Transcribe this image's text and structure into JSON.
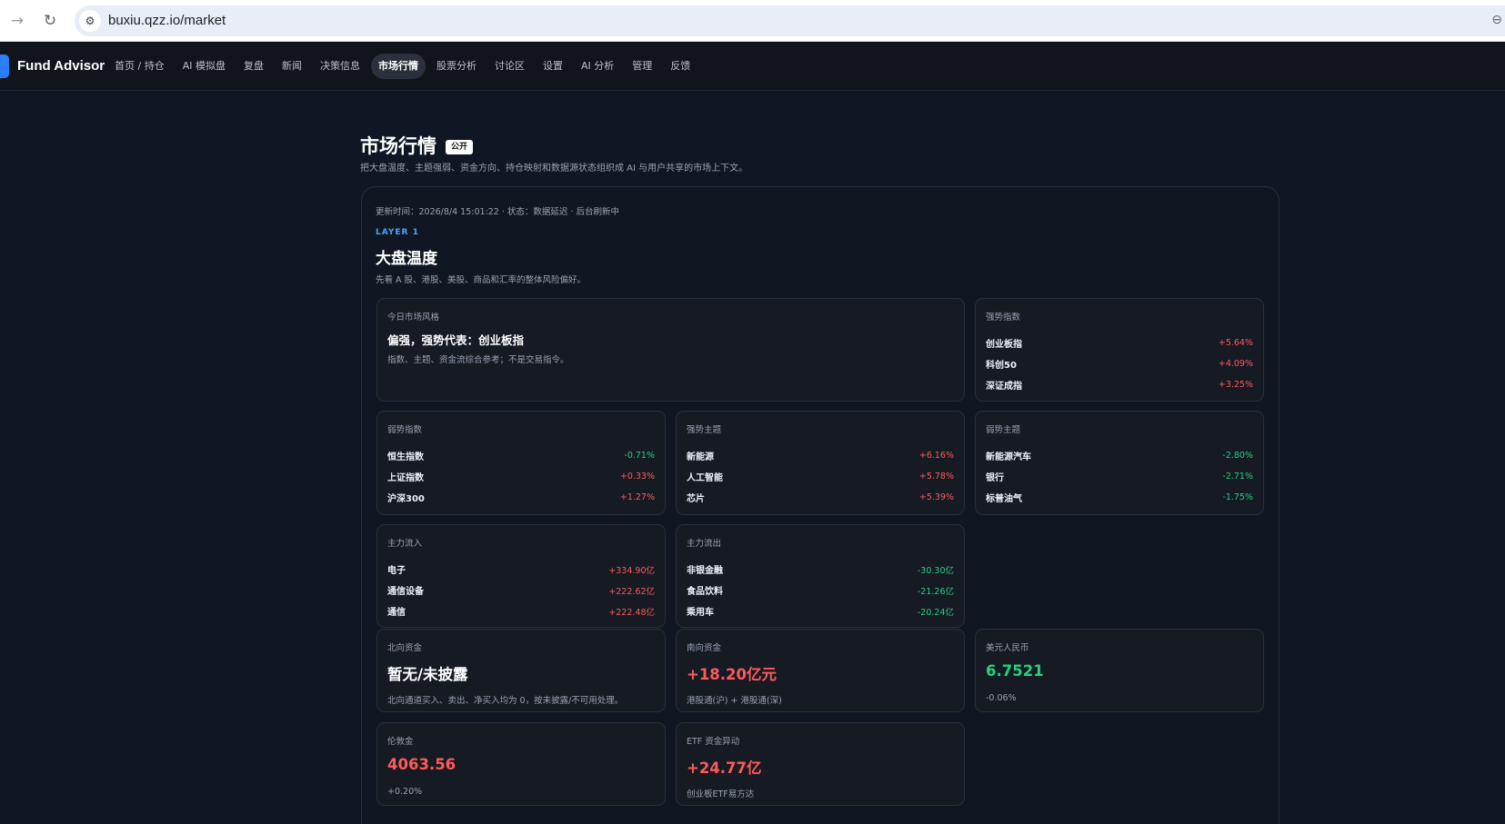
{
  "browser": {
    "url": "buxiu.qzz.io/market"
  },
  "app": {
    "brand": "Fund Advisor",
    "nav": [
      {
        "label": "首页 / 持仓"
      },
      {
        "label": "AI 模拟盘"
      },
      {
        "label": "复盘"
      },
      {
        "label": "新闻"
      },
      {
        "label": "决策信息"
      },
      {
        "label": "市场行情",
        "active": true
      },
      {
        "label": "股票分析"
      },
      {
        "label": "讨论区"
      },
      {
        "label": "设置"
      },
      {
        "label": "AI 分析"
      },
      {
        "label": "管理"
      },
      {
        "label": "反馈"
      }
    ]
  },
  "page": {
    "title": "市场行情",
    "badge": "公开",
    "subtitle": "把大盘温度、主题强弱、资金方向、持仓映射和数据源状态组织成 AI 与用户共享的市场上下文。"
  },
  "panel": {
    "update_line": "更新时间：2026/8/4 15:01:22 · 状态：数据延迟 · 后台刷新中",
    "layer": "LAYER 1",
    "title": "大盘温度",
    "desc": "先看 A 股、港股、美股、商品和汇率的整体风险偏好。"
  },
  "style_card": {
    "label": "今日市场风格",
    "headline": "偏强，强势代表：创业板指",
    "note": "指数、主题、资金流综合参考；不是交易指令。"
  },
  "lists": {
    "strong_index": {
      "label": "强势指数",
      "rows": [
        {
          "name": "创业板指",
          "value": "+5.64%",
          "dir": "up"
        },
        {
          "name": "科创50",
          "value": "+4.09%",
          "dir": "up"
        },
        {
          "name": "深证成指",
          "value": "+3.25%",
          "dir": "up"
        }
      ]
    },
    "weak_index": {
      "label": "弱势指数",
      "rows": [
        {
          "name": "恒生指数",
          "value": "-0.71%",
          "dir": "down"
        },
        {
          "name": "上证指数",
          "value": "+0.33%",
          "dir": "up"
        },
        {
          "name": "沪深300",
          "value": "+1.27%",
          "dir": "up"
        }
      ]
    },
    "strong_theme": {
      "label": "强势主题",
      "rows": [
        {
          "name": "新能源",
          "value": "+6.16%",
          "dir": "up"
        },
        {
          "name": "人工智能",
          "value": "+5.78%",
          "dir": "up"
        },
        {
          "name": "芯片",
          "value": "+5.39%",
          "dir": "up"
        }
      ]
    },
    "weak_theme": {
      "label": "弱势主题",
      "rows": [
        {
          "name": "新能源汽车",
          "value": "-2.80%",
          "dir": "down"
        },
        {
          "name": "银行",
          "value": "-2.71%",
          "dir": "down"
        },
        {
          "name": "标普油气",
          "value": "-1.75%",
          "dir": "down"
        }
      ]
    },
    "main_inflow": {
      "label": "主力流入",
      "rows": [
        {
          "name": "电子",
          "value": "+334.90亿",
          "dir": "up"
        },
        {
          "name": "通信设备",
          "value": "+222.62亿",
          "dir": "up"
        },
        {
          "name": "通信",
          "value": "+222.48亿",
          "dir": "up"
        }
      ]
    },
    "main_outflow": {
      "label": "主力流出",
      "rows": [
        {
          "name": "非银金融",
          "value": "-30.30亿",
          "dir": "down"
        },
        {
          "name": "食品饮料",
          "value": "-21.26亿",
          "dir": "down"
        },
        {
          "name": "乘用车",
          "value": "-20.24亿",
          "dir": "down"
        }
      ]
    }
  },
  "metrics": {
    "northbound": {
      "label": "北向资金",
      "value": "暂无/未披露",
      "note": "北向通道买入、卖出、净买入均为 0，按未披露/不可用处理。"
    },
    "southbound": {
      "label": "南向资金",
      "value": "+18.20亿元",
      "note": "港股通(沪) + 港股通(深)"
    },
    "usdcny": {
      "label": "美元人民币",
      "value": "6.7521",
      "note": "-0.06%"
    },
    "london_gold": {
      "label": "伦敦金",
      "value": "4063.56",
      "note": "+0.20%"
    },
    "etf_flow": {
      "label": "ETF 资金异动",
      "value": "+24.77亿",
      "note": "创业板ETF易方达"
    }
  },
  "colors": {
    "up": "#ff5a5a",
    "down": "#27d17f",
    "accent": "#4ea1ff",
    "background": "#0f1724",
    "card": "#151a23"
  }
}
